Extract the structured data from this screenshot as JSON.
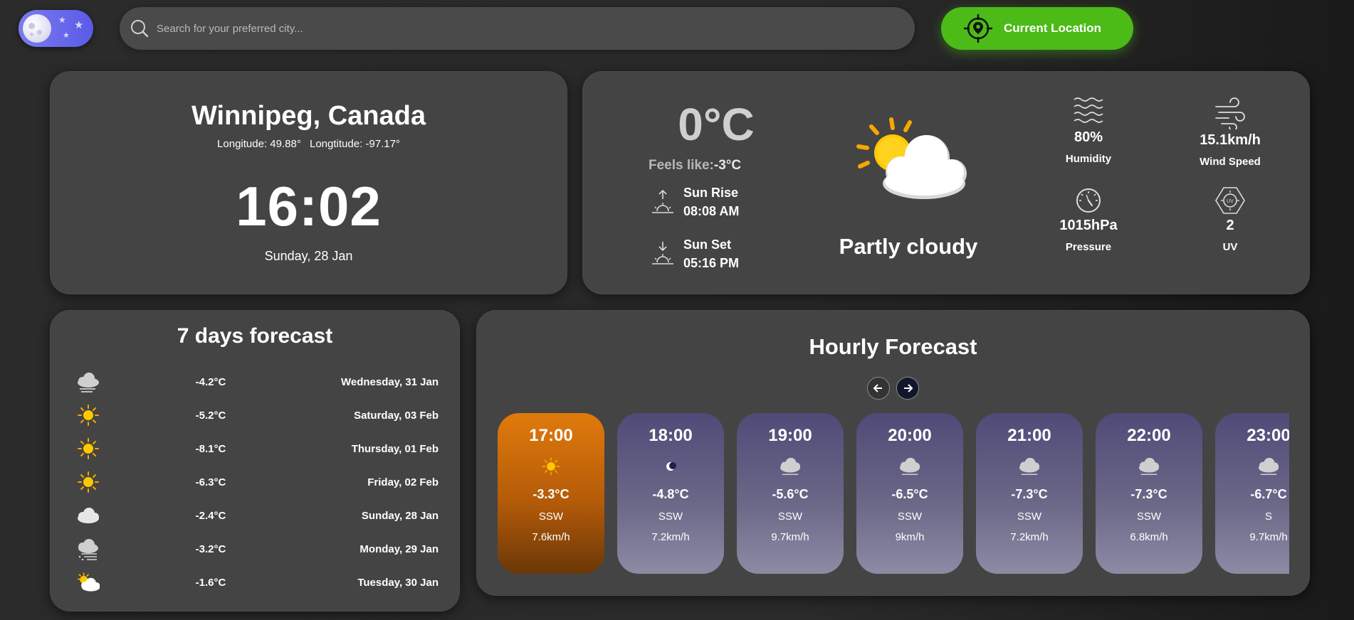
{
  "search": {
    "placeholder": "Search for your preferred city..."
  },
  "location_button": {
    "label": "Current Location"
  },
  "city_card": {
    "city": "Winnipeg, Canada",
    "lon_label_1": "Longitude: 49.88°",
    "lon_label_2": "Longtitude: -97.17°",
    "time": "16:02",
    "date": "Sunday, 28 Jan"
  },
  "current": {
    "temp": "0°C",
    "feels_like_label": "Feels like:",
    "feels_like_value": "-3°C",
    "sunrise_label": "Sun Rise",
    "sunrise_time": "08:08 AM",
    "sunset_label": "Sun Set",
    "sunset_time": "05:16 PM",
    "condition": "Partly cloudy",
    "icon": "partly-cloudy-icon",
    "humidity": {
      "value": "80%",
      "label": "Humidity",
      "icon": "humidity-icon"
    },
    "wind": {
      "value": "15.1km/h",
      "label": "Wind Speed",
      "icon": "wind-icon"
    },
    "pressure": {
      "value": "1015hPa",
      "label": "Pressure",
      "icon": "pressure-icon"
    },
    "uv": {
      "value": "2",
      "label": "UV",
      "icon": "uv-icon"
    }
  },
  "week": {
    "title": "7 days forecast",
    "days": [
      {
        "icon": "cloud-rain-icon",
        "temp": "-4.2°C",
        "date": "Wednesday, 31 Jan"
      },
      {
        "icon": "sun-icon",
        "temp": "-5.2°C",
        "date": "Saturday, 03 Feb"
      },
      {
        "icon": "sun-icon",
        "temp": "-8.1°C",
        "date": "Thursday, 01 Feb"
      },
      {
        "icon": "sun-icon",
        "temp": "-6.3°C",
        "date": "Friday, 02 Feb"
      },
      {
        "icon": "cloud-icon",
        "temp": "-2.4°C",
        "date": "Sunday, 28 Jan"
      },
      {
        "icon": "cloud-snow-icon",
        "temp": "-3.2°C",
        "date": "Monday, 29 Jan"
      },
      {
        "icon": "partly-cloudy-icon",
        "temp": "-1.6°C",
        "date": "Tuesday, 30 Jan"
      }
    ]
  },
  "hourly": {
    "title": "Hourly Forecast",
    "items": [
      {
        "time": "17:00",
        "icon": "sun-icon",
        "temp": "-3.3°C",
        "dir": "SSW",
        "speed": "7.6km/h",
        "active": true
      },
      {
        "time": "18:00",
        "icon": "moon-icon",
        "temp": "-4.8°C",
        "dir": "SSW",
        "speed": "7.2km/h"
      },
      {
        "time": "19:00",
        "icon": "cloud-icon",
        "temp": "-5.6°C",
        "dir": "SSW",
        "speed": "9.7km/h"
      },
      {
        "time": "20:00",
        "icon": "cloud-icon",
        "temp": "-6.5°C",
        "dir": "SSW",
        "speed": "9km/h"
      },
      {
        "time": "21:00",
        "icon": "cloud-icon",
        "temp": "-7.3°C",
        "dir": "SSW",
        "speed": "7.2km/h"
      },
      {
        "time": "22:00",
        "icon": "cloud-icon",
        "temp": "-7.3°C",
        "dir": "SSW",
        "speed": "6.8km/h"
      },
      {
        "time": "23:00",
        "icon": "cloud-icon",
        "temp": "-6.7°C",
        "dir": "S",
        "speed": "9.7km/h"
      }
    ]
  },
  "colors": {
    "accent_green": "#4cbb17",
    "active_hour": "#e07a0c",
    "card": "#444444"
  }
}
